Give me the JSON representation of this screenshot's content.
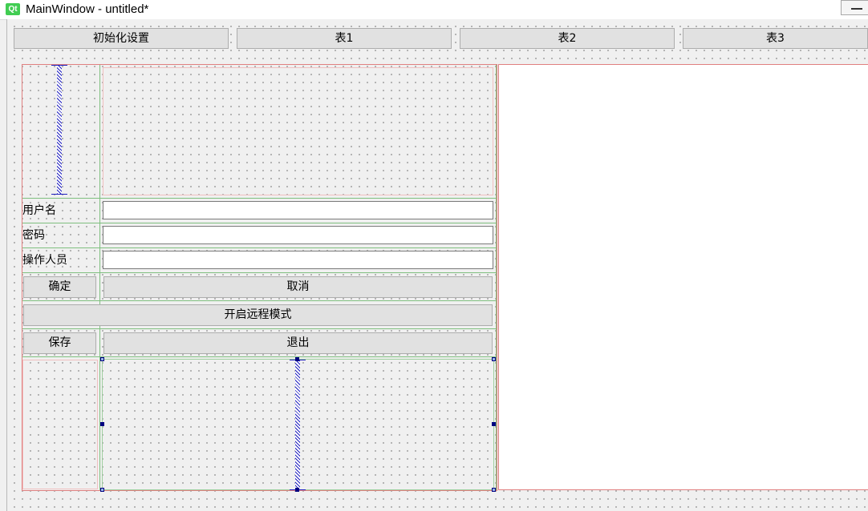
{
  "window": {
    "logo_text": "Qt",
    "title": "MainWindow - untitled*"
  },
  "top_buttons": {
    "init_settings": "初始化设置",
    "table1": "表1",
    "table2": "表2",
    "table3": "表3"
  },
  "form": {
    "username_label": "用户名",
    "username_value": "",
    "password_label": "密码",
    "password_value": "",
    "operator_label": "操作人员",
    "operator_value": "",
    "confirm": "确定",
    "cancel": "取消",
    "remote_mode": "开启远程模式",
    "save": "保存",
    "exit": "退出"
  },
  "colors": {
    "layout_red": "#e08080",
    "layout_green": "#7fbf7f",
    "spacer_blue": "#2020c0",
    "qt_green": "#41cd52"
  }
}
